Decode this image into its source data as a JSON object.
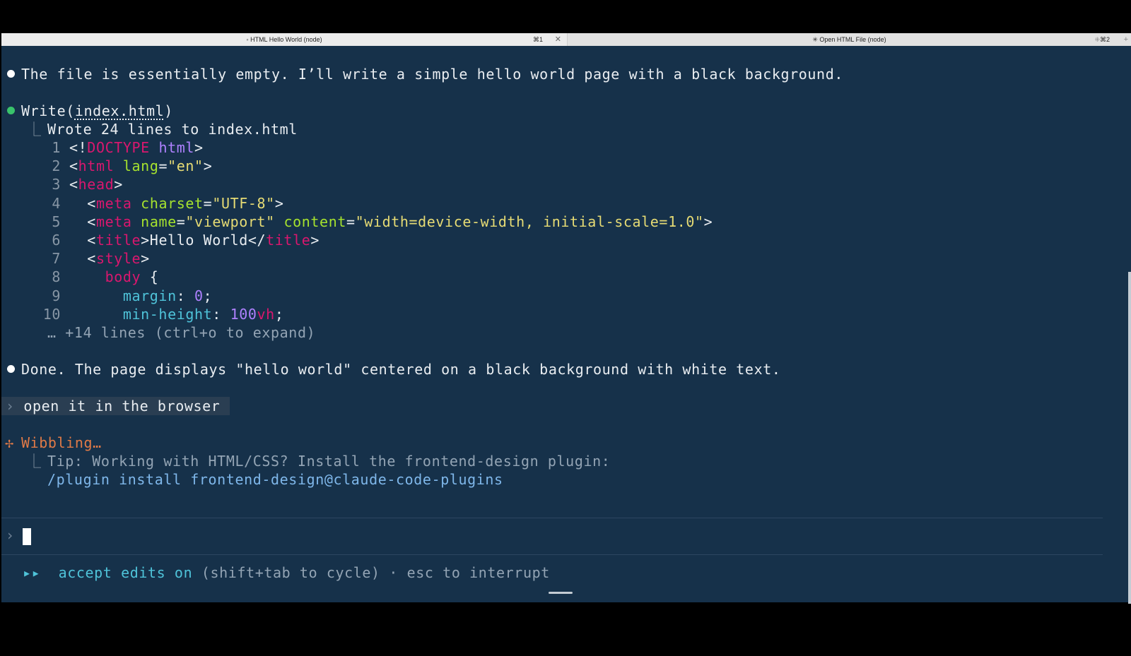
{
  "tabs": [
    {
      "title": "◦ HTML Hello World (node)",
      "key": "⌘1",
      "close": "✕"
    },
    {
      "title": "✳ Open HTML File (node)",
      "key": "⌘2",
      "spinner": "⁜",
      "plus": "+"
    }
  ],
  "messages": {
    "msg1": "The file is essentially empty. I’ll write a simple hello world page with a black background.",
    "write_prefix": "Write(",
    "write_file": "index.html",
    "write_suffix": ")",
    "wrote_branch": "⎿",
    "wrote": "Wrote 24 lines to index.html",
    "code_lines": [
      {
        "n": "1",
        "parts": [
          [
            "t",
            "<!"
          ],
          [
            "pink",
            "DOCTYPE"
          ],
          [
            "t",
            " "
          ],
          [
            "purple",
            "html"
          ],
          [
            "t",
            ">"
          ]
        ]
      },
      {
        "n": "2",
        "parts": [
          [
            "t",
            "<"
          ],
          [
            "pink",
            "html"
          ],
          [
            "t",
            " "
          ],
          [
            "green-t",
            "lang"
          ],
          [
            "t",
            "="
          ],
          [
            "yellow",
            "\"en\""
          ],
          [
            "t",
            ">"
          ]
        ]
      },
      {
        "n": "3",
        "parts": [
          [
            "t",
            "<"
          ],
          [
            "pink",
            "head"
          ],
          [
            "t",
            ">"
          ]
        ]
      },
      {
        "n": "4",
        "parts": [
          [
            "t",
            "  <"
          ],
          [
            "pink",
            "meta"
          ],
          [
            "t",
            " "
          ],
          [
            "green-t",
            "charset"
          ],
          [
            "t",
            "="
          ],
          [
            "yellow",
            "\"UTF-8\""
          ],
          [
            "t",
            ">"
          ]
        ]
      },
      {
        "n": "5",
        "parts": [
          [
            "t",
            "  <"
          ],
          [
            "pink",
            "meta"
          ],
          [
            "t",
            " "
          ],
          [
            "green-t",
            "name"
          ],
          [
            "t",
            "="
          ],
          [
            "yellow",
            "\"viewport\""
          ],
          [
            "t",
            " "
          ],
          [
            "green-t",
            "content"
          ],
          [
            "t",
            "="
          ],
          [
            "yellow",
            "\"width=device-width, initial-scale=1.0\""
          ],
          [
            "t",
            ">"
          ]
        ]
      },
      {
        "n": "6",
        "parts": [
          [
            "t",
            "  <"
          ],
          [
            "pink",
            "title"
          ],
          [
            "t",
            ">Hello World</"
          ],
          [
            "pink",
            "title"
          ],
          [
            "t",
            ">"
          ]
        ]
      },
      {
        "n": "7",
        "parts": [
          [
            "t",
            "  <"
          ],
          [
            "pink",
            "style"
          ],
          [
            "t",
            ">"
          ]
        ]
      },
      {
        "n": "8",
        "parts": [
          [
            "t",
            "    "
          ],
          [
            "pink",
            "body"
          ],
          [
            "t",
            " {"
          ]
        ]
      },
      {
        "n": "9",
        "parts": [
          [
            "t",
            "      "
          ],
          [
            "cyan",
            "margin"
          ],
          [
            "t",
            ": "
          ],
          [
            "purple",
            "0"
          ],
          [
            "t",
            ";"
          ]
        ]
      },
      {
        "n": "10",
        "parts": [
          [
            "t",
            "      "
          ],
          [
            "cyan",
            "min-height"
          ],
          [
            "t",
            ": "
          ],
          [
            "purple",
            "100"
          ],
          [
            "pink",
            "vh"
          ],
          [
            "t",
            ";"
          ]
        ]
      }
    ],
    "more_lines": "… +14 lines (ctrl+o to expand)",
    "done": "Done. The page displays \"hello world\" centered on a black background with white text.",
    "prompt_chevron": "›",
    "user_prompt": "open it in the browser",
    "spinner_icon": "✢",
    "status": "Wibbling…",
    "tip_branch": "⎿",
    "tip": "Tip: Working with HTML/CSS? Install the frontend-design plugin:",
    "tip_cmd": "/plugin install frontend-design@claude-code-plugins"
  },
  "input": {
    "chevron": "›",
    "value": ""
  },
  "footer": {
    "icon": "▸▸",
    "mode": "accept edits on",
    "rest": "(shift+tab to cycle) · esc to interrupt"
  },
  "colors": {
    "terminal_bg": "#16314a",
    "accent_green": "#39c36b",
    "spinner_orange": "#e07a47",
    "tag_pink": "#d9176e"
  }
}
